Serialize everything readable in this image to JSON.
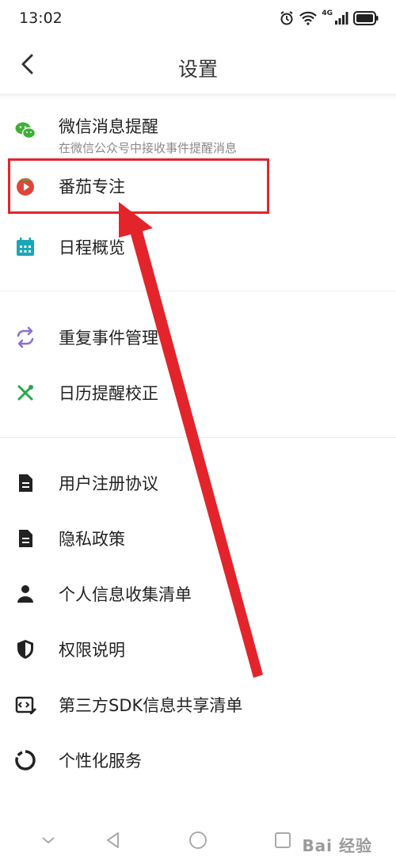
{
  "status": {
    "time": "13:02",
    "network": "4G"
  },
  "header": {
    "title": "设置"
  },
  "items": [
    {
      "label": "微信消息提醒",
      "sub": "在微信公众号中接收事件提醒消息",
      "icon": "wechat-icon"
    },
    {
      "label": "番茄专注",
      "icon": "tomato-icon"
    },
    {
      "label": "日程概览",
      "icon": "calendar-icon"
    },
    {
      "label": "重复事件管理",
      "icon": "repeat-icon"
    },
    {
      "label": "日历提醒校正",
      "icon": "tools-icon"
    },
    {
      "label": "用户注册协议",
      "icon": "document-icon"
    },
    {
      "label": "隐私政策",
      "icon": "document-icon"
    },
    {
      "label": "个人信息收集清单",
      "icon": "person-icon"
    },
    {
      "label": "权限说明",
      "icon": "shield-icon"
    },
    {
      "label": "第三方SDK信息共享清单",
      "icon": "sdk-icon"
    },
    {
      "label": "个性化服务",
      "icon": "ring-icon"
    }
  ],
  "colors": {
    "wechat": "#3cb034",
    "tomato": "#e0453a",
    "calendar": "#19a7b7",
    "repeat": "#8a6fd6",
    "tools": "#27a84a",
    "highlight": "#e3242b"
  },
  "watermark": "Bai 经验"
}
